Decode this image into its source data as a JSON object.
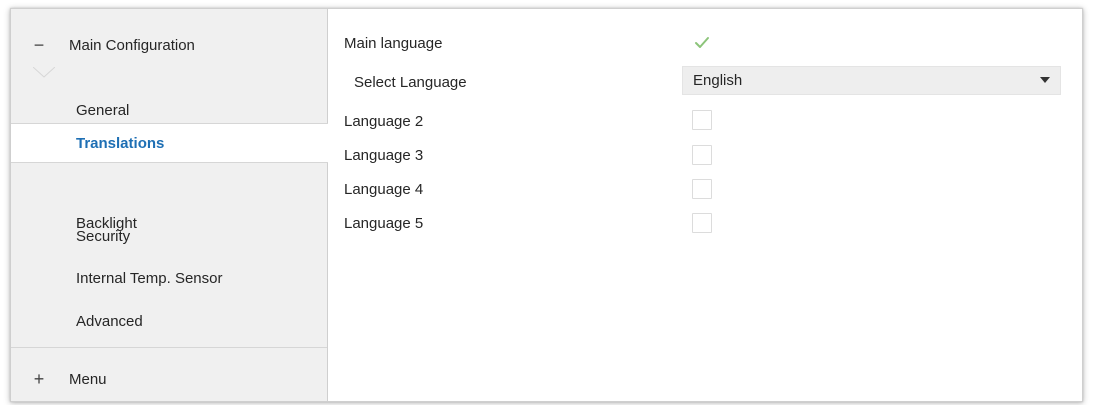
{
  "sidebar": {
    "main_group": {
      "toggle": "−",
      "label": "Main Configuration",
      "expanded": true
    },
    "items": [
      {
        "label": "General",
        "active": false
      },
      {
        "label": "Translations",
        "active": true
      },
      {
        "label": "Backlight",
        "active": false
      },
      {
        "label": "Security",
        "active": false
      },
      {
        "label": "Internal Temp. Sensor",
        "active": false
      },
      {
        "label": "Advanced",
        "active": false
      }
    ],
    "menu_group": {
      "toggle": "+",
      "label": "Menu",
      "expanded": false
    }
  },
  "content": {
    "main_language": {
      "label": "Main language",
      "checked": true
    },
    "select_language": {
      "label": "Select Language",
      "value": "English"
    },
    "languages": [
      {
        "label": "Language 2",
        "checked": false
      },
      {
        "label": "Language 3",
        "checked": false
      },
      {
        "label": "Language 4",
        "checked": false
      },
      {
        "label": "Language 5",
        "checked": false
      }
    ]
  },
  "colors": {
    "active_text": "#1e6fb4",
    "check_mark": "#8cc47a",
    "sidebar_bg": "#f0f0f0"
  },
  "icons": {
    "collapse": "minus-icon",
    "expand": "plus-icon",
    "check": "checkmark-icon",
    "dropdown": "chevron-down-icon"
  }
}
